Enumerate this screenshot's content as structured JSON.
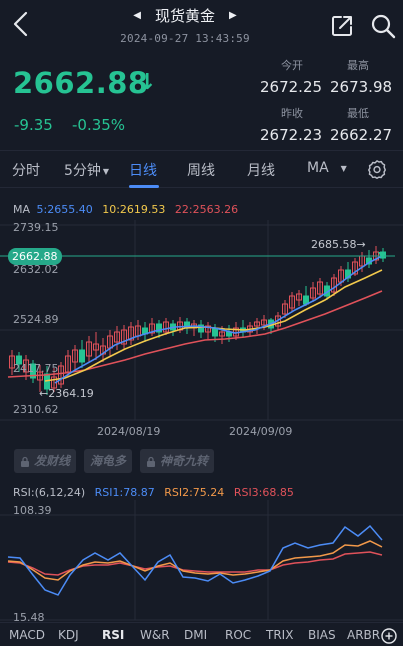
{
  "header": {
    "title": "现货黄金",
    "datetime": "2024-09-27 13:43:59",
    "prev_arrow": "◀",
    "next_arrow": "▶"
  },
  "quote": {
    "price": "2662.88",
    "direction_arrow": "↓",
    "change": "-9.35",
    "change_pct": "-0.35%",
    "open_label": "今开",
    "open": "2672.25",
    "high_label": "最高",
    "high": "2673.98",
    "prev_close_label": "昨收",
    "prev_close": "2672.23",
    "low_label": "最低",
    "low": "2662.27"
  },
  "period_tabs": {
    "items": [
      "分时",
      "5分钟",
      "日线",
      "周线",
      "月线",
      "MA"
    ],
    "active": "日线"
  },
  "ma_legend": {
    "label": "MA",
    "ma5": "5:2655.40",
    "ma10": "10:2619.53",
    "ma22": "22:2563.26"
  },
  "main_chart": {
    "y_ticks": [
      "2739.15",
      "2632.02",
      "2524.89",
      "2417.75",
      "2310.62"
    ],
    "last_price_tag": "2662.88",
    "high_annotation": "2685.58→",
    "low_annotation": "←2364.19",
    "x_ticks": [
      "2024/08/19",
      "2024/09/09"
    ]
  },
  "feature_chips": [
    {
      "label": "发财线"
    },
    {
      "label": "海龟多"
    },
    {
      "label": "神奇九转"
    }
  ],
  "rsi_legend": {
    "label": "RSI:(6,12,24)",
    "rsi1": "RSI1:78.87",
    "rsi2": "RSI2:75.24",
    "rsi3": "RSI3:68.85"
  },
  "rsi_chart": {
    "y_top": "108.39",
    "y_bottom": "15.48"
  },
  "indicator_tabs": {
    "items": [
      "MACD",
      "KDJ",
      "RSI",
      "W&R",
      "DMI",
      "ROC",
      "TRIX",
      "BIAS",
      "ARBR"
    ],
    "active": "RSI"
  },
  "colors": {
    "background": "#161b26",
    "up": "#e0525a",
    "down": "#26c393",
    "accent": "#4c8cf6",
    "ma5": "#4c8cf6",
    "ma10": "#f2c94c",
    "ma22": "#e0525a",
    "rsi1": "#4c8cf6",
    "rsi2": "#f2994a",
    "rsi3": "#e0525a"
  },
  "icons": {
    "back": "chevron-left-icon",
    "share": "share-icon",
    "search": "search-icon",
    "settings": "gear-icon",
    "lock": "lock-icon",
    "add": "plus-circle-icon"
  }
}
